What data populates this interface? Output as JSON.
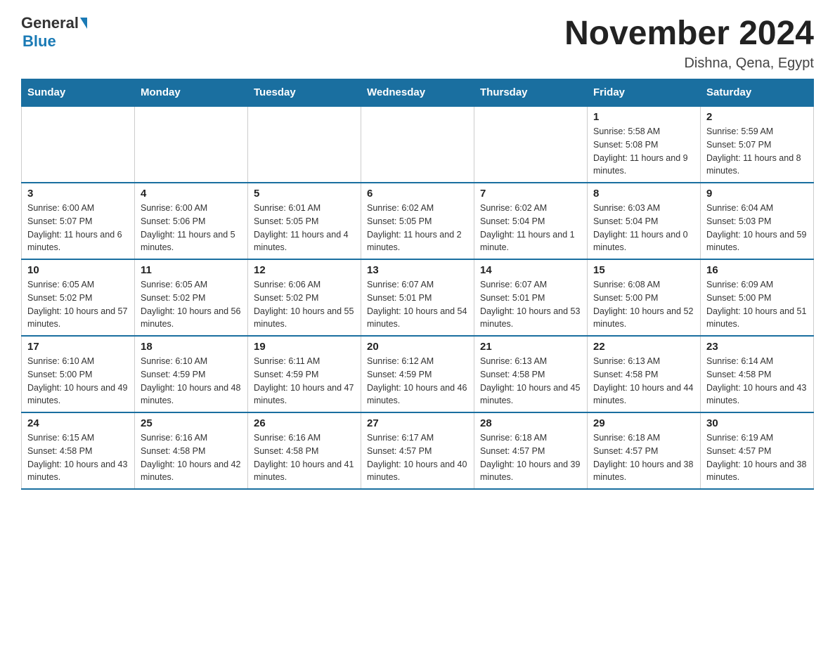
{
  "header": {
    "logo_main": "General",
    "logo_sub": "Blue",
    "month_title": "November 2024",
    "location": "Dishna, Qena, Egypt"
  },
  "weekdays": [
    "Sunday",
    "Monday",
    "Tuesday",
    "Wednesday",
    "Thursday",
    "Friday",
    "Saturday"
  ],
  "weeks": [
    [
      {
        "day": "",
        "sunrise": "",
        "sunset": "",
        "daylight": ""
      },
      {
        "day": "",
        "sunrise": "",
        "sunset": "",
        "daylight": ""
      },
      {
        "day": "",
        "sunrise": "",
        "sunset": "",
        "daylight": ""
      },
      {
        "day": "",
        "sunrise": "",
        "sunset": "",
        "daylight": ""
      },
      {
        "day": "",
        "sunrise": "",
        "sunset": "",
        "daylight": ""
      },
      {
        "day": "1",
        "sunrise": "Sunrise: 5:58 AM",
        "sunset": "Sunset: 5:08 PM",
        "daylight": "Daylight: 11 hours and 9 minutes."
      },
      {
        "day": "2",
        "sunrise": "Sunrise: 5:59 AM",
        "sunset": "Sunset: 5:07 PM",
        "daylight": "Daylight: 11 hours and 8 minutes."
      }
    ],
    [
      {
        "day": "3",
        "sunrise": "Sunrise: 6:00 AM",
        "sunset": "Sunset: 5:07 PM",
        "daylight": "Daylight: 11 hours and 6 minutes."
      },
      {
        "day": "4",
        "sunrise": "Sunrise: 6:00 AM",
        "sunset": "Sunset: 5:06 PM",
        "daylight": "Daylight: 11 hours and 5 minutes."
      },
      {
        "day": "5",
        "sunrise": "Sunrise: 6:01 AM",
        "sunset": "Sunset: 5:05 PM",
        "daylight": "Daylight: 11 hours and 4 minutes."
      },
      {
        "day": "6",
        "sunrise": "Sunrise: 6:02 AM",
        "sunset": "Sunset: 5:05 PM",
        "daylight": "Daylight: 11 hours and 2 minutes."
      },
      {
        "day": "7",
        "sunrise": "Sunrise: 6:02 AM",
        "sunset": "Sunset: 5:04 PM",
        "daylight": "Daylight: 11 hours and 1 minute."
      },
      {
        "day": "8",
        "sunrise": "Sunrise: 6:03 AM",
        "sunset": "Sunset: 5:04 PM",
        "daylight": "Daylight: 11 hours and 0 minutes."
      },
      {
        "day": "9",
        "sunrise": "Sunrise: 6:04 AM",
        "sunset": "Sunset: 5:03 PM",
        "daylight": "Daylight: 10 hours and 59 minutes."
      }
    ],
    [
      {
        "day": "10",
        "sunrise": "Sunrise: 6:05 AM",
        "sunset": "Sunset: 5:02 PM",
        "daylight": "Daylight: 10 hours and 57 minutes."
      },
      {
        "day": "11",
        "sunrise": "Sunrise: 6:05 AM",
        "sunset": "Sunset: 5:02 PM",
        "daylight": "Daylight: 10 hours and 56 minutes."
      },
      {
        "day": "12",
        "sunrise": "Sunrise: 6:06 AM",
        "sunset": "Sunset: 5:02 PM",
        "daylight": "Daylight: 10 hours and 55 minutes."
      },
      {
        "day": "13",
        "sunrise": "Sunrise: 6:07 AM",
        "sunset": "Sunset: 5:01 PM",
        "daylight": "Daylight: 10 hours and 54 minutes."
      },
      {
        "day": "14",
        "sunrise": "Sunrise: 6:07 AM",
        "sunset": "Sunset: 5:01 PM",
        "daylight": "Daylight: 10 hours and 53 minutes."
      },
      {
        "day": "15",
        "sunrise": "Sunrise: 6:08 AM",
        "sunset": "Sunset: 5:00 PM",
        "daylight": "Daylight: 10 hours and 52 minutes."
      },
      {
        "day": "16",
        "sunrise": "Sunrise: 6:09 AM",
        "sunset": "Sunset: 5:00 PM",
        "daylight": "Daylight: 10 hours and 51 minutes."
      }
    ],
    [
      {
        "day": "17",
        "sunrise": "Sunrise: 6:10 AM",
        "sunset": "Sunset: 5:00 PM",
        "daylight": "Daylight: 10 hours and 49 minutes."
      },
      {
        "day": "18",
        "sunrise": "Sunrise: 6:10 AM",
        "sunset": "Sunset: 4:59 PM",
        "daylight": "Daylight: 10 hours and 48 minutes."
      },
      {
        "day": "19",
        "sunrise": "Sunrise: 6:11 AM",
        "sunset": "Sunset: 4:59 PM",
        "daylight": "Daylight: 10 hours and 47 minutes."
      },
      {
        "day": "20",
        "sunrise": "Sunrise: 6:12 AM",
        "sunset": "Sunset: 4:59 PM",
        "daylight": "Daylight: 10 hours and 46 minutes."
      },
      {
        "day": "21",
        "sunrise": "Sunrise: 6:13 AM",
        "sunset": "Sunset: 4:58 PM",
        "daylight": "Daylight: 10 hours and 45 minutes."
      },
      {
        "day": "22",
        "sunrise": "Sunrise: 6:13 AM",
        "sunset": "Sunset: 4:58 PM",
        "daylight": "Daylight: 10 hours and 44 minutes."
      },
      {
        "day": "23",
        "sunrise": "Sunrise: 6:14 AM",
        "sunset": "Sunset: 4:58 PM",
        "daylight": "Daylight: 10 hours and 43 minutes."
      }
    ],
    [
      {
        "day": "24",
        "sunrise": "Sunrise: 6:15 AM",
        "sunset": "Sunset: 4:58 PM",
        "daylight": "Daylight: 10 hours and 43 minutes."
      },
      {
        "day": "25",
        "sunrise": "Sunrise: 6:16 AM",
        "sunset": "Sunset: 4:58 PM",
        "daylight": "Daylight: 10 hours and 42 minutes."
      },
      {
        "day": "26",
        "sunrise": "Sunrise: 6:16 AM",
        "sunset": "Sunset: 4:58 PM",
        "daylight": "Daylight: 10 hours and 41 minutes."
      },
      {
        "day": "27",
        "sunrise": "Sunrise: 6:17 AM",
        "sunset": "Sunset: 4:57 PM",
        "daylight": "Daylight: 10 hours and 40 minutes."
      },
      {
        "day": "28",
        "sunrise": "Sunrise: 6:18 AM",
        "sunset": "Sunset: 4:57 PM",
        "daylight": "Daylight: 10 hours and 39 minutes."
      },
      {
        "day": "29",
        "sunrise": "Sunrise: 6:18 AM",
        "sunset": "Sunset: 4:57 PM",
        "daylight": "Daylight: 10 hours and 38 minutes."
      },
      {
        "day": "30",
        "sunrise": "Sunrise: 6:19 AM",
        "sunset": "Sunset: 4:57 PM",
        "daylight": "Daylight: 10 hours and 38 minutes."
      }
    ]
  ]
}
